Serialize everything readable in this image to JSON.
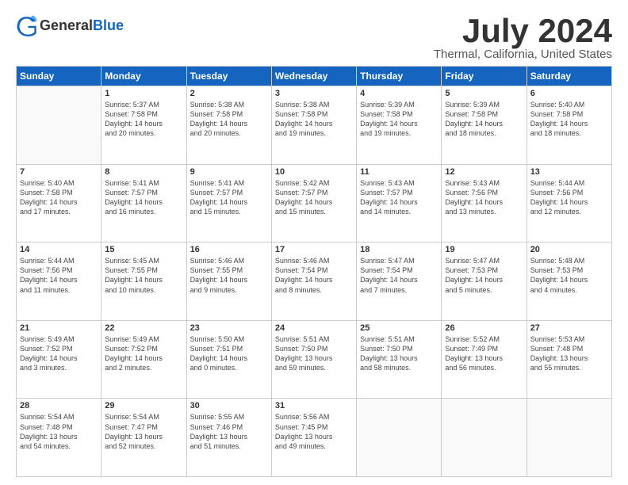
{
  "header": {
    "logo_general": "General",
    "logo_blue": "Blue",
    "title": "July 2024",
    "location": "Thermal, California, United States"
  },
  "days_of_week": [
    "Sunday",
    "Monday",
    "Tuesday",
    "Wednesday",
    "Thursday",
    "Friday",
    "Saturday"
  ],
  "weeks": [
    [
      {
        "day": "",
        "info": ""
      },
      {
        "day": "1",
        "info": "Sunrise: 5:37 AM\nSunset: 7:58 PM\nDaylight: 14 hours\nand 20 minutes."
      },
      {
        "day": "2",
        "info": "Sunrise: 5:38 AM\nSunset: 7:58 PM\nDaylight: 14 hours\nand 20 minutes."
      },
      {
        "day": "3",
        "info": "Sunrise: 5:38 AM\nSunset: 7:58 PM\nDaylight: 14 hours\nand 19 minutes."
      },
      {
        "day": "4",
        "info": "Sunrise: 5:39 AM\nSunset: 7:58 PM\nDaylight: 14 hours\nand 19 minutes."
      },
      {
        "day": "5",
        "info": "Sunrise: 5:39 AM\nSunset: 7:58 PM\nDaylight: 14 hours\nand 18 minutes."
      },
      {
        "day": "6",
        "info": "Sunrise: 5:40 AM\nSunset: 7:58 PM\nDaylight: 14 hours\nand 18 minutes."
      }
    ],
    [
      {
        "day": "7",
        "info": "Sunrise: 5:40 AM\nSunset: 7:58 PM\nDaylight: 14 hours\nand 17 minutes."
      },
      {
        "day": "8",
        "info": "Sunrise: 5:41 AM\nSunset: 7:57 PM\nDaylight: 14 hours\nand 16 minutes."
      },
      {
        "day": "9",
        "info": "Sunrise: 5:41 AM\nSunset: 7:57 PM\nDaylight: 14 hours\nand 15 minutes."
      },
      {
        "day": "10",
        "info": "Sunrise: 5:42 AM\nSunset: 7:57 PM\nDaylight: 14 hours\nand 15 minutes."
      },
      {
        "day": "11",
        "info": "Sunrise: 5:43 AM\nSunset: 7:57 PM\nDaylight: 14 hours\nand 14 minutes."
      },
      {
        "day": "12",
        "info": "Sunrise: 5:43 AM\nSunset: 7:56 PM\nDaylight: 14 hours\nand 13 minutes."
      },
      {
        "day": "13",
        "info": "Sunrise: 5:44 AM\nSunset: 7:56 PM\nDaylight: 14 hours\nand 12 minutes."
      }
    ],
    [
      {
        "day": "14",
        "info": "Sunrise: 5:44 AM\nSunset: 7:56 PM\nDaylight: 14 hours\nand 11 minutes."
      },
      {
        "day": "15",
        "info": "Sunrise: 5:45 AM\nSunset: 7:55 PM\nDaylight: 14 hours\nand 10 minutes."
      },
      {
        "day": "16",
        "info": "Sunrise: 5:46 AM\nSunset: 7:55 PM\nDaylight: 14 hours\nand 9 minutes."
      },
      {
        "day": "17",
        "info": "Sunrise: 5:46 AM\nSunset: 7:54 PM\nDaylight: 14 hours\nand 8 minutes."
      },
      {
        "day": "18",
        "info": "Sunrise: 5:47 AM\nSunset: 7:54 PM\nDaylight: 14 hours\nand 7 minutes."
      },
      {
        "day": "19",
        "info": "Sunrise: 5:47 AM\nSunset: 7:53 PM\nDaylight: 14 hours\nand 5 minutes."
      },
      {
        "day": "20",
        "info": "Sunrise: 5:48 AM\nSunset: 7:53 PM\nDaylight: 14 hours\nand 4 minutes."
      }
    ],
    [
      {
        "day": "21",
        "info": "Sunrise: 5:49 AM\nSunset: 7:52 PM\nDaylight: 14 hours\nand 3 minutes."
      },
      {
        "day": "22",
        "info": "Sunrise: 5:49 AM\nSunset: 7:52 PM\nDaylight: 14 hours\nand 2 minutes."
      },
      {
        "day": "23",
        "info": "Sunrise: 5:50 AM\nSunset: 7:51 PM\nDaylight: 14 hours\nand 0 minutes."
      },
      {
        "day": "24",
        "info": "Sunrise: 5:51 AM\nSunset: 7:50 PM\nDaylight: 13 hours\nand 59 minutes."
      },
      {
        "day": "25",
        "info": "Sunrise: 5:51 AM\nSunset: 7:50 PM\nDaylight: 13 hours\nand 58 minutes."
      },
      {
        "day": "26",
        "info": "Sunrise: 5:52 AM\nSunset: 7:49 PM\nDaylight: 13 hours\nand 56 minutes."
      },
      {
        "day": "27",
        "info": "Sunrise: 5:53 AM\nSunset: 7:48 PM\nDaylight: 13 hours\nand 55 minutes."
      }
    ],
    [
      {
        "day": "28",
        "info": "Sunrise: 5:54 AM\nSunset: 7:48 PM\nDaylight: 13 hours\nand 54 minutes."
      },
      {
        "day": "29",
        "info": "Sunrise: 5:54 AM\nSunset: 7:47 PM\nDaylight: 13 hours\nand 52 minutes."
      },
      {
        "day": "30",
        "info": "Sunrise: 5:55 AM\nSunset: 7:46 PM\nDaylight: 13 hours\nand 51 minutes."
      },
      {
        "day": "31",
        "info": "Sunrise: 5:56 AM\nSunset: 7:45 PM\nDaylight: 13 hours\nand 49 minutes."
      },
      {
        "day": "",
        "info": ""
      },
      {
        "day": "",
        "info": ""
      },
      {
        "day": "",
        "info": ""
      }
    ]
  ]
}
